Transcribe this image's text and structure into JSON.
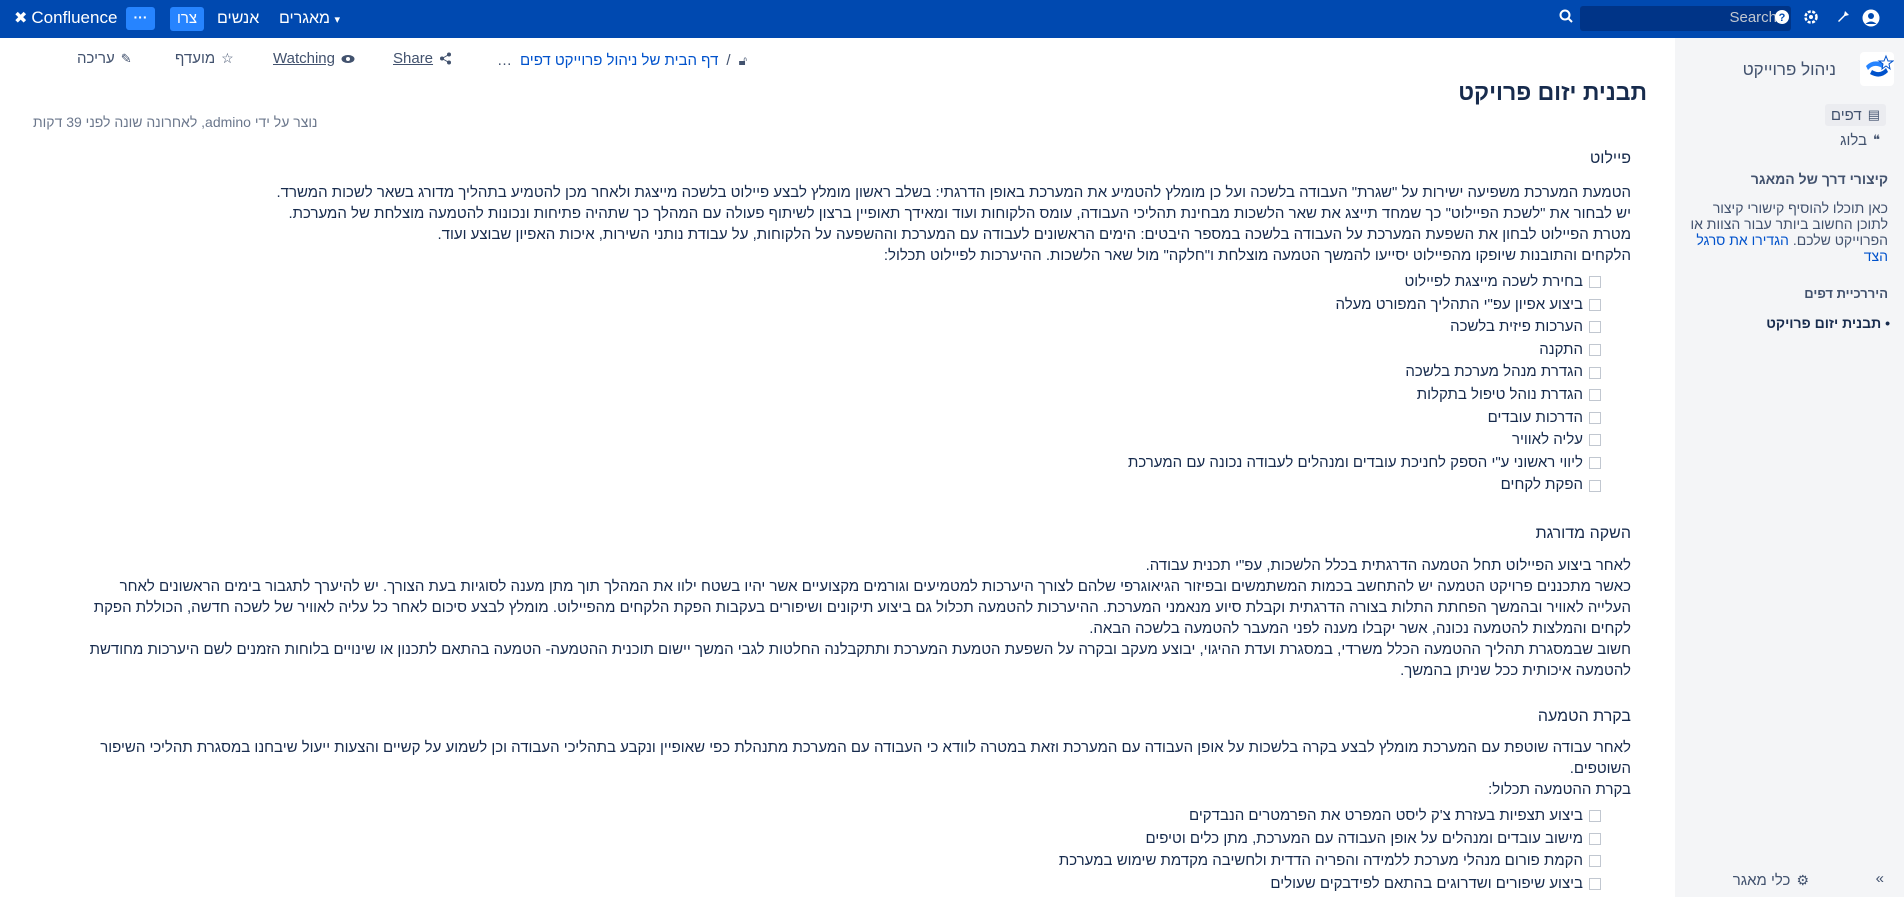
{
  "topbar": {
    "logo": "Confluence",
    "more": "···",
    "create": "צרו",
    "people": "אנשים",
    "spaces": "מאגרים",
    "search_placeholder": "Search"
  },
  "sidebar": {
    "space_name": "ניהול פרוייקט",
    "pages": "דפים",
    "blog": "בלוג",
    "shortcuts_title": "קיצורי דרך של המאגר",
    "shortcuts_text": "כאן תוכלו להוסיף קישורי קיצור לתוכן החשוב ביותר עבור הצוות או הפרוייקט שלכם.",
    "shortcuts_link": "הגדירו את סרגל הצד",
    "tree_title": "היררכיית דפים",
    "tree_item": "תבנית יזום פרויקט",
    "footer": "כלי מאגר"
  },
  "page": {
    "breadcrumb_home": "דף הבית של ניהול פרוייקט דפים",
    "edit": "עריכה",
    "favorite": "מועדף",
    "watching": "Watching",
    "share": "Share",
    "title": "תבנית יזום פרויקט",
    "meta": "נוצר על ידי admino, לאחרונה שונה לפני 39 דקות"
  },
  "content": {
    "pilot": {
      "heading": "פיילוט",
      "lines": [
        "הטמעת המערכת משפיעה ישירות על \"שגרת\" העבודה בלשכה ועל כן מומלץ להטמיע את המערכת באופן הדרגתי: בשלב ראשון מומלץ לבצע פיילוט בלשכה מייצגת ולאחר מכן להטמיע בתהליך מדורג בשאר לשכות המשרד.",
        "יש לבחור את \"לשכת הפיילוט\" כך שמחד תייצג את שאר הלשכות מבחינת תהליכי העבודה, עומס הלקוחות ועוד ומאידך תאופיין ברצון לשיתוף פעולה עם המהלך כך שתהיה פתיחות ונכונות להטמעה מוצלחת של המערכת.",
        "מטרת הפיילוט לבחון את השפעת המערכת על העבודה בלשכה במספר היבטים: הימים הראשונים לעבודה עם המערכת וההשפעה על הלקוחות, על עבודת נותני השירות, איכות האפיון שבוצע ועוד.",
        "הלקחים והתובנות שיופקו מהפיילוט יסייעו להמשך הטמעה מוצלחת ו\"חלקה\" מול שאר הלשכות. ההיערכות לפיילוט תכלול:"
      ],
      "tasks": [
        "בחירת לשכה מייצגת לפיילוט",
        "ביצוע אפיון עפ\"י התהליך המפורט מעלה",
        "הערכות פיזית בלשכה",
        "התקנה",
        "הגדרת מנהל מערכת בלשכה",
        "הגדרת נוהל טיפול בתקלות",
        "הדרכות עובדים",
        "עליה לאוויר",
        "ליווי ראשוני ע\"י הספק לחניכת עובדים ומנהלים לעבודה נכונה עם המערכת",
        "הפקת לקחים"
      ]
    },
    "rollout": {
      "heading": "השקה מדורגת",
      "lines": [
        "לאחר ביצוע הפיילוט תחל הטמעה הדרגתית בכלל הלשכות, עפ\"י תכנית עבודה.",
        "כאשר מתכננים פרויקט הטמעה יש להתחשב בכמות המשתמשים ובפיזור הגיאוגרפי שלהם לצורך היערכות למטמיעים וגורמים מקצועיים אשר יהיו בשטח ילוו את המהלך תוך מתן מענה לסוגיות בעת הצורך. יש להיערך לתגבור בימים הראשונים לאחר",
        "העלייה לאוויר ובהמשך הפחתת התלות בצורה הדרגתית וקבלת סיוע מנאמני המערכת. ההיערכות להטמעה תכלול גם ביצוע תיקונים ושיפורים בעקבות הפקת הלקחים מהפיילוט. מומלץ לבצע סיכום לאחר כל עליה לאוויר של לשכה חדשה, הכוללת הפקת",
        "לקחים והמלצות להטמעה נכונה, אשר יקבלו מענה לפני המעבר להטמעה בלשכה הבאה.",
        "חשוב שבמסגרת תהליך ההטמעה הכלל משרדי, במסגרת ועדת ההיגוי, יבוצע מעקב ובקרה על השפעת הטמעת המערכת ותתקבלנה החלטות לגבי המשך יישום תוכנית ההטמעה- הטמעה בהתאם לתכנון או שינויים בלוחות הזמנים לשם היערכות מחודשת",
        "להטמעה איכותית ככל שניתן בהמשך."
      ]
    },
    "control": {
      "heading": "בקרת הטמעה",
      "lines": [
        "לאחר עבודה שוטפת עם המערכת מומלץ לבצע בקרה בלשכות על אופן העבודה עם המערכת וזאת במטרה לוודא כי העבודה עם המערכת מתנהלת כפי שאופיין ונקבע בתהליכי העבודה וכן לשמוע על קשיים והצעות ייעול שיבחנו במסגרת תהליכי השיפור",
        "השוטפים.",
        "בקרת ההטמעה תכלול:"
      ],
      "tasks": [
        "ביצוע תצפיות בעזרת צ'ק ליסט המפרט את הפרמטרים הנבדקים",
        "מישוב עובדים ומנהלים על אופן העבודה עם המערכת, מתן כלים וטיפים",
        "הקמת פורום מנהלי מערכת ללמידה והפריה הדדית ולחשיבה מקדמת שימוש במערכת",
        "ביצוע שיפורים ושדרוגים בהתאם לפידבקים שעולים"
      ]
    }
  }
}
